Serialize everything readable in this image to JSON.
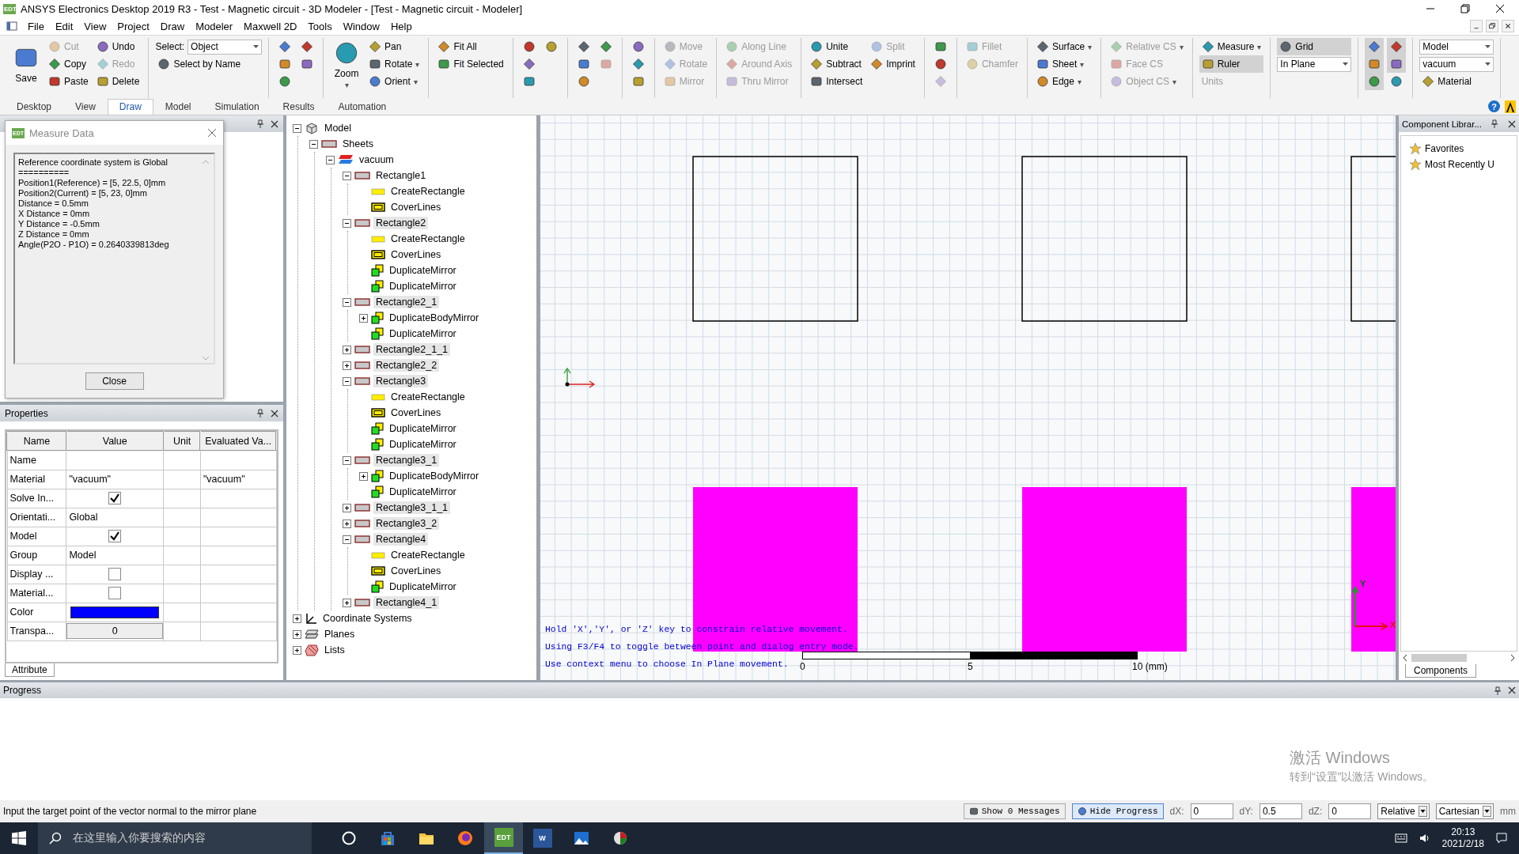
{
  "window": {
    "title": "ANSYS Electronics Desktop 2019 R3 - Test - Magnetic circuit - 3D Modeler - [Test - Magnetic circuit - Modeler]",
    "icon_label": "EDT"
  },
  "menu": [
    "File",
    "Edit",
    "View",
    "Project",
    "Draw",
    "Modeler",
    "Maxwell 2D",
    "Tools",
    "Window",
    "Help"
  ],
  "ribbon": {
    "groups": [
      {
        "columns": [
          [
            {
              "kind": "large",
              "label": "Save",
              "disabled": false
            }
          ],
          [
            {
              "kind": "small",
              "label": "Cut",
              "disabled": true
            },
            {
              "kind": "small",
              "label": "Copy",
              "disabled": false
            },
            {
              "kind": "small",
              "label": "Paste",
              "disabled": false
            }
          ],
          [
            {
              "kind": "small",
              "label": "Undo",
              "disabled": false
            },
            {
              "kind": "small",
              "label": "Redo",
              "disabled": true
            },
            {
              "kind": "small",
              "label": "Delete",
              "disabled": false
            }
          ]
        ]
      },
      {
        "columns": [
          [
            {
              "kind": "select",
              "label": "Select:",
              "value": "Object",
              "disabled": false
            },
            {
              "kind": "small",
              "label": "Select by Name",
              "disabled": false
            }
          ]
        ]
      },
      {
        "columns": [
          [
            {
              "kind": "icon",
              "disabled": false
            },
            {
              "kind": "icon",
              "disabled": false
            },
            {
              "kind": "icon",
              "disabled": false
            }
          ],
          [
            {
              "kind": "icon",
              "disabled": false
            },
            {
              "kind": "icon",
              "disabled": false
            }
          ]
        ]
      },
      {
        "columns": [
          [
            {
              "kind": "large",
              "label": "Zoom",
              "caret": "▾",
              "disabled": false
            }
          ],
          [
            {
              "kind": "small",
              "label": "Pan",
              "disabled": false
            },
            {
              "kind": "small",
              "label": "Rotate",
              "caret": "▾",
              "disabled": false
            },
            {
              "kind": "small",
              "label": "Orient",
              "caret": "▾",
              "disabled": false
            }
          ]
        ]
      },
      {
        "columns": [
          [
            {
              "kind": "small",
              "label": "Fit All",
              "disabled": false
            },
            {
              "kind": "small",
              "label": "Fit Selected",
              "disabled": false
            }
          ]
        ]
      },
      {
        "columns": [
          [
            {
              "kind": "icon",
              "disabled": false
            },
            {
              "kind": "icon",
              "disabled": false
            },
            {
              "kind": "icon",
              "disabled": false
            }
          ],
          [
            {
              "kind": "icon",
              "disabled": false
            }
          ]
        ]
      },
      {
        "columns": [
          [
            {
              "kind": "icon",
              "disabled": false
            },
            {
              "kind": "icon",
              "disabled": false
            },
            {
              "kind": "icon",
              "disabled": false
            }
          ],
          [
            {
              "kind": "icon",
              "disabled": false
            },
            {
              "kind": "icon",
              "disabled": true
            }
          ]
        ]
      },
      {
        "columns": [
          [
            {
              "kind": "icon",
              "disabled": false
            },
            {
              "kind": "icon",
              "disabled": false
            },
            {
              "kind": "icon",
              "disabled": false
            }
          ]
        ]
      },
      {
        "columns": [
          [
            {
              "kind": "small",
              "label": "Move",
              "disabled": true
            },
            {
              "kind": "small",
              "label": "Rotate",
              "disabled": true
            },
            {
              "kind": "small",
              "label": "Mirror",
              "disabled": true
            }
          ]
        ]
      },
      {
        "columns": [
          [
            {
              "kind": "small",
              "label": "Along Line",
              "disabled": true
            },
            {
              "kind": "small",
              "label": "Around Axis",
              "disabled": true
            },
            {
              "kind": "small",
              "label": "Thru Mirror",
              "disabled": true
            }
          ]
        ]
      },
      {
        "columns": [
          [
            {
              "kind": "small",
              "label": "Unite",
              "disabled": false
            },
            {
              "kind": "small",
              "label": "Subtract",
              "disabled": false
            },
            {
              "kind": "small",
              "label": "Intersect",
              "disabled": false
            }
          ],
          [
            {
              "kind": "small",
              "label": "Split",
              "disabled": true
            },
            {
              "kind": "small",
              "label": "Imprint",
              "disabled": false
            }
          ]
        ]
      },
      {
        "columns": [
          [
            {
              "kind": "icon",
              "disabled": false
            },
            {
              "kind": "icon",
              "disabled": false
            },
            {
              "kind": "icon",
              "disabled": true
            }
          ]
        ]
      },
      {
        "columns": [
          [
            {
              "kind": "small",
              "label": "Fillet",
              "disabled": true
            },
            {
              "kind": "small",
              "label": "Chamfer",
              "disabled": true
            }
          ]
        ]
      },
      {
        "columns": [
          [
            {
              "kind": "small",
              "label": "Surface",
              "caret": "▾",
              "disabled": false
            },
            {
              "kind": "small",
              "label": "Sheet",
              "caret": "▾",
              "disabled": false
            },
            {
              "kind": "small",
              "label": "Edge",
              "caret": "▾",
              "disabled": false
            }
          ]
        ]
      },
      {
        "columns": [
          [
            {
              "kind": "small",
              "label": "Relative CS",
              "caret": "▾",
              "disabled": true
            },
            {
              "kind": "small",
              "label": "Face CS",
              "disabled": true
            },
            {
              "kind": "small",
              "label": "Object CS",
              "caret": "▾",
              "disabled": true
            }
          ]
        ]
      },
      {
        "columns": [
          [
            {
              "kind": "small",
              "label": "Measure",
              "caret": "▾",
              "disabled": false
            },
            {
              "kind": "toggle",
              "label": "Ruler",
              "selected": true,
              "disabled": false
            },
            {
              "kind": "note",
              "label": "Units",
              "disabled": true
            }
          ]
        ]
      },
      {
        "columns": [
          [
            {
              "kind": "toggle",
              "label": "Grid",
              "selected": true,
              "disabled": false
            },
            {
              "kind": "select",
              "value": "In Plane",
              "disabled": false
            }
          ]
        ]
      },
      {
        "columns": [
          [
            {
              "kind": "toggle-icon",
              "selected": true,
              "disabled": false
            },
            {
              "kind": "toggle-icon",
              "selected": true,
              "disabled": false
            },
            {
              "kind": "toggle-icon",
              "selected": true,
              "disabled": false
            }
          ],
          [
            {
              "kind": "toggle-icon",
              "selected": true,
              "disabled": false
            },
            {
              "kind": "toggle-icon",
              "selected": true,
              "disabled": false
            },
            {
              "kind": "toggle-icon",
              "selected": false,
              "disabled": false
            }
          ]
        ]
      },
      {
        "columns": [
          [
            {
              "kind": "select",
              "value": "Model",
              "disabled": false
            },
            {
              "kind": "select",
              "value": "vacuum",
              "disabled": false
            },
            {
              "kind": "small",
              "label": "Material",
              "disabled": false
            }
          ]
        ]
      }
    ]
  },
  "ribbon_tabs": [
    {
      "label": "Desktop",
      "selected": false
    },
    {
      "label": "View",
      "selected": false
    },
    {
      "label": "Draw",
      "selected": true
    },
    {
      "label": "Model",
      "selected": false
    },
    {
      "label": "Simulation",
      "selected": false
    },
    {
      "label": "Results",
      "selected": false
    },
    {
      "label": "Automation",
      "selected": false
    }
  ],
  "help_glyph": "?",
  "measure_dialog": {
    "title": "Measure Data",
    "icon_label": "EDT",
    "lines": [
      "Reference coordinate system is Global",
      "==========",
      "Position1(Reference) = [5, 22.5, 0]mm",
      "Position2(Current) = [5, 23, 0]mm",
      "Distance = 0.5mm",
      "X Distance = 0mm",
      "Y Distance = -0.5mm",
      "Z Distance = 0mm",
      "Angle(P2O - P1O) = 0.2640339813deg"
    ],
    "close_button": "Close"
  },
  "properties": {
    "title": "Properties",
    "columns": [
      "Name",
      "Value",
      "Unit",
      "Evaluated Va..."
    ],
    "rows": [
      {
        "name": "Name",
        "kind": "text"
      },
      {
        "name": "Material",
        "kind": "text",
        "value": "\"vacuum\"",
        "evaluated": "\"vacuum\""
      },
      {
        "name": "Solve In...",
        "kind": "check",
        "checked": true
      },
      {
        "name": "Orientati...",
        "kind": "text",
        "value": "Global"
      },
      {
        "name": "Model",
        "kind": "check",
        "checked": true
      },
      {
        "name": "Group",
        "kind": "text",
        "value": "Model"
      },
      {
        "name": "Display ...",
        "kind": "check",
        "checked": false
      },
      {
        "name": "Material...",
        "kind": "check",
        "checked": false
      },
      {
        "name": "Color",
        "kind": "color",
        "color": "#0000ff"
      },
      {
        "name": "Transpa...",
        "kind": "button",
        "value": "0"
      }
    ],
    "tab": "Attribute"
  },
  "model_tree": [
    {
      "label": "Model",
      "kind": "model",
      "expanded": true,
      "selected": false,
      "children": [
        {
          "label": "Sheets",
          "kind": "group",
          "expanded": true,
          "selected": false,
          "children": [
            {
              "label": "vacuum",
              "kind": "material",
              "expanded": true,
              "selected": false,
              "children": [
                {
                  "label": "Rectangle1",
                  "kind": "object",
                  "expanded": true,
                  "selected": false,
                  "children": [
                    {
                      "label": "CreateRectangle",
                      "kind": "create",
                      "selected": false
                    },
                    {
                      "label": "CoverLines",
                      "kind": "cover",
                      "selected": false
                    }
                  ]
                },
                {
                  "label": "Rectangle2",
                  "kind": "object",
                  "expanded": true,
                  "selected": true,
                  "children": [
                    {
                      "label": "CreateRectangle",
                      "kind": "create",
                      "selected": false
                    },
                    {
                      "label": "CoverLines",
                      "kind": "cover",
                      "selected": false
                    },
                    {
                      "label": "DuplicateMirror",
                      "kind": "mirror",
                      "selected": false
                    },
                    {
                      "label": "DuplicateMirror",
                      "kind": "mirror",
                      "selected": false
                    }
                  ]
                },
                {
                  "label": "Rectangle2_1",
                  "kind": "object",
                  "expanded": true,
                  "selected": true,
                  "children": [
                    {
                      "label": "DuplicateBodyMirror",
                      "kind": "mirror",
                      "expanded": false,
                      "selected": false
                    },
                    {
                      "label": "DuplicateMirror",
                      "kind": "mirror",
                      "selected": false
                    }
                  ]
                },
                {
                  "label": "Rectangle2_1_1",
                  "kind": "object",
                  "expanded": false,
                  "selected": true
                },
                {
                  "label": "Rectangle2_2",
                  "kind": "object",
                  "expanded": false,
                  "selected": true
                },
                {
                  "label": "Rectangle3",
                  "kind": "object",
                  "expanded": true,
                  "selected": true,
                  "children": [
                    {
                      "label": "CreateRectangle",
                      "kind": "create",
                      "selected": false
                    },
                    {
                      "label": "CoverLines",
                      "kind": "cover",
                      "selected": false
                    },
                    {
                      "label": "DuplicateMirror",
                      "kind": "mirror",
                      "selected": false
                    },
                    {
                      "label": "DuplicateMirror",
                      "kind": "mirror",
                      "selected": false
                    }
                  ]
                },
                {
                  "label": "Rectangle3_1",
                  "kind": "object",
                  "expanded": true,
                  "selected": true,
                  "children": [
                    {
                      "label": "DuplicateBodyMirror",
                      "kind": "mirror",
                      "expanded": false,
                      "selected": false
                    },
                    {
                      "label": "DuplicateMirror",
                      "kind": "mirror",
                      "selected": false
                    }
                  ]
                },
                {
                  "label": "Rectangle3_1_1",
                  "kind": "object",
                  "expanded": false,
                  "selected": true
                },
                {
                  "label": "Rectangle3_2",
                  "kind": "object",
                  "expanded": false,
                  "selected": true
                },
                {
                  "label": "Rectangle4",
                  "kind": "object",
                  "expanded": true,
                  "selected": true,
                  "children": [
                    {
                      "label": "CreateRectangle",
                      "kind": "create",
                      "selected": false
                    },
                    {
                      "label": "CoverLines",
                      "kind": "cover",
                      "selected": false
                    },
                    {
                      "label": "DuplicateMirror",
                      "kind": "mirror",
                      "selected": false
                    }
                  ]
                },
                {
                  "label": "Rectangle4_1",
                  "kind": "object",
                  "expanded": false,
                  "selected": true
                }
              ]
            }
          ]
        }
      ]
    },
    {
      "label": "Coordinate Systems",
      "kind": "cs",
      "expanded": false,
      "selected": false
    },
    {
      "label": "Planes",
      "kind": "plane",
      "expanded": false,
      "selected": false
    },
    {
      "label": "Lists",
      "kind": "list",
      "expanded": false,
      "selected": false
    }
  ],
  "viewport": {
    "shapes": [
      {
        "filled": false
      },
      {
        "filled": false
      },
      {
        "filled": false
      },
      {
        "filled": true
      },
      {
        "filled": true
      },
      {
        "filled": true
      }
    ],
    "hints": [
      "Hold 'X','Y', or 'Z' key to constrain relative movement.",
      "Using F3/F4 to toggle between point and dialog entry mode.",
      "Use context menu to choose In Plane movement."
    ],
    "ruler_labels": [
      "0",
      "5",
      "10 (mm)"
    ],
    "triad_labels": [
      "X",
      "Y"
    ]
  },
  "component_library": {
    "title": "Component Librar...",
    "items": [
      "Favorites",
      "Most Recently U"
    ],
    "tab": "Components"
  },
  "progress": {
    "title": "Progress",
    "os_notice": [
      "激活 Windows",
      "转到“设置”以激活 Windows。"
    ]
  },
  "status_bar": {
    "message": "Input the target point of the vector normal to the mirror plane",
    "buttons": [
      "Show 0 Messages",
      "Hide Progress"
    ],
    "fields": [
      {
        "label": "dX:",
        "value": "0"
      },
      {
        "label": "dY:",
        "value": "0.5"
      },
      {
        "label": "dZ:",
        "value": "0"
      }
    ],
    "selects": [
      "Relative",
      "Cartesian"
    ],
    "unit": "mm"
  },
  "taskbar": {
    "search_placeholder": "在这里输入你要搜索的内容",
    "apps": [
      {
        "kind": "cortana",
        "selected": false
      },
      {
        "kind": "store",
        "selected": false
      },
      {
        "kind": "folder",
        "selected": false
      },
      {
        "kind": "firefox",
        "selected": false
      },
      {
        "kind": "edt",
        "label": "EDT",
        "selected": true
      },
      {
        "kind": "word",
        "label": "W",
        "selected": false
      },
      {
        "kind": "photos",
        "selected": false
      },
      {
        "kind": "app",
        "selected": false
      }
    ],
    "time": "20:13",
    "date": "2021/2/18"
  }
}
